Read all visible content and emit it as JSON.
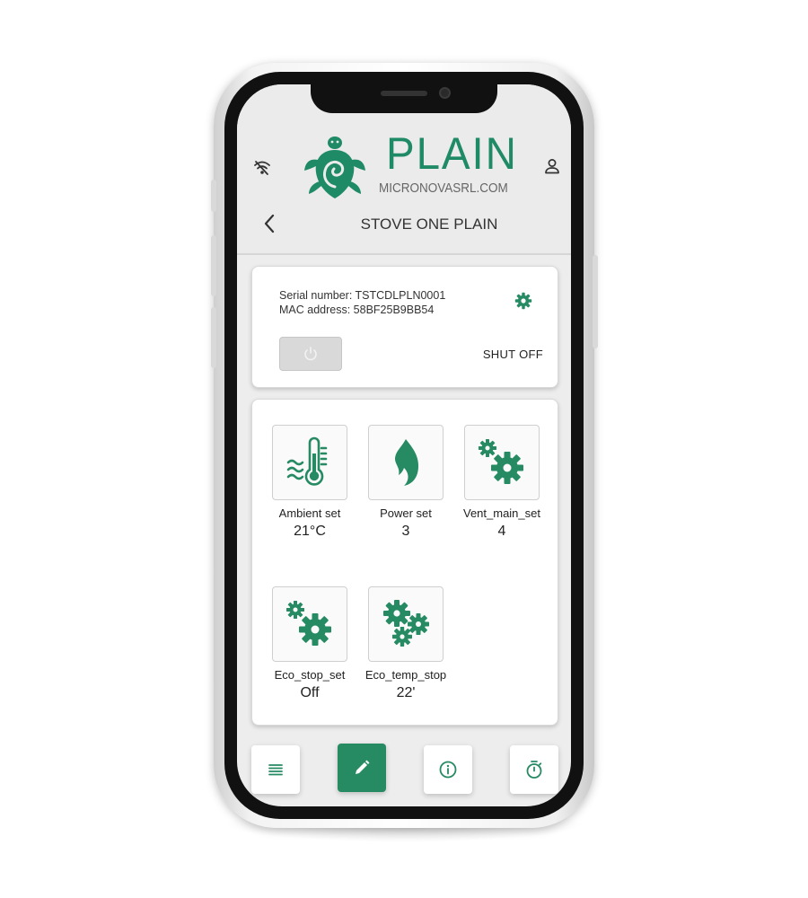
{
  "header": {
    "brand_name": "PLAIN",
    "brand_site": "MICRONOVASRL.COM",
    "page_title": "STOVE ONE PLAIN"
  },
  "device": {
    "serial_label": "Serial number: TSTCDLPLN0001",
    "mac_label": "MAC address: 58BF25B9BB54",
    "status": "SHUT OFF"
  },
  "settings": [
    {
      "label": "Ambient set",
      "value": "21°C",
      "icon": "thermometer-icon"
    },
    {
      "label": "Power set",
      "value": "3",
      "icon": "flame-icon"
    },
    {
      "label": "Vent_main_set",
      "value": "4",
      "icon": "gears-icon"
    },
    {
      "label": "Eco_stop_set",
      "value": "Off",
      "icon": "gears-icon"
    },
    {
      "label": "Eco_temp_stop",
      "value": "22'",
      "icon": "triple-gears-icon"
    }
  ],
  "nav": [
    "menu-icon",
    "edit-icon",
    "info-icon",
    "timer-icon"
  ],
  "colors": {
    "accent": "#268a63",
    "screen_bg": "#ededed",
    "card_bg": "#ffffff",
    "disabled_button": "#d9d9d9"
  }
}
